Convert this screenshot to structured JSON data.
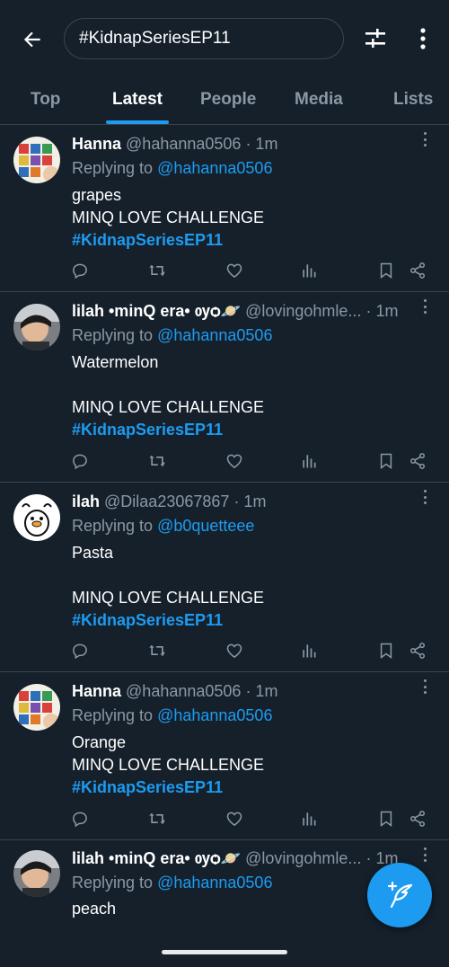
{
  "header": {
    "search_value": "#KidnapSeriesEP11"
  },
  "tabs": [
    {
      "label": "Top"
    },
    {
      "label": "Latest"
    },
    {
      "label": "People"
    },
    {
      "label": "Media"
    },
    {
      "label": "Lists"
    }
  ],
  "tweets": [
    {
      "name": "Hanna",
      "handle": "@hahanna0506",
      "time": "· 1m",
      "replying_prefix": "Replying to ",
      "replying_to": "@hahanna0506",
      "lines": [
        "grapes",
        "MINQ LOVE CHALLENGE"
      ],
      "hashtag": "#KidnapSeriesEP11"
    },
    {
      "name": "lilah •minQ era• ѹѻ🪐",
      "handle": "@lovingohmle...",
      "time": "· 1m",
      "replying_prefix": "Replying to ",
      "replying_to": "@hahanna0506",
      "lines": [
        "Watermelon",
        "MINQ LOVE CHALLENGE"
      ],
      "hashtag": "#KidnapSeriesEP11"
    },
    {
      "name": "ilah",
      "handle": "@Dilaa23067867",
      "time": "· 1m",
      "replying_prefix": "Replying to ",
      "replying_to": "@b0quetteee",
      "lines": [
        "Pasta",
        "MINQ LOVE CHALLENGE"
      ],
      "hashtag": "#KidnapSeriesEP11"
    },
    {
      "name": "Hanna",
      "handle": "@hahanna0506",
      "time": "· 1m",
      "replying_prefix": "Replying to ",
      "replying_to": "@hahanna0506",
      "lines": [
        "Orange",
        "MINQ LOVE CHALLENGE"
      ],
      "hashtag": "#KidnapSeriesEP11"
    },
    {
      "name": "lilah •minQ era• ѹѻ🪐",
      "handle": "@lovingohmle...",
      "time": "· 1m",
      "replying_prefix": "Replying to ",
      "replying_to": "@hahanna0506",
      "lines": [
        "peach"
      ]
    }
  ],
  "icons": {
    "back": "arrow-left-icon",
    "filter": "sliders-icon",
    "more": "more-vertical-icon",
    "reply": "reply-icon",
    "retweet": "retweet-icon",
    "like": "heart-icon",
    "views": "views-icon",
    "bookmark": "bookmark-icon",
    "share": "share-icon",
    "compose": "compose-feather-icon"
  },
  "colors": {
    "background": "#15202b",
    "accent": "#1d9bf0",
    "muted": "#8b98a5",
    "divider": "#38444d"
  }
}
